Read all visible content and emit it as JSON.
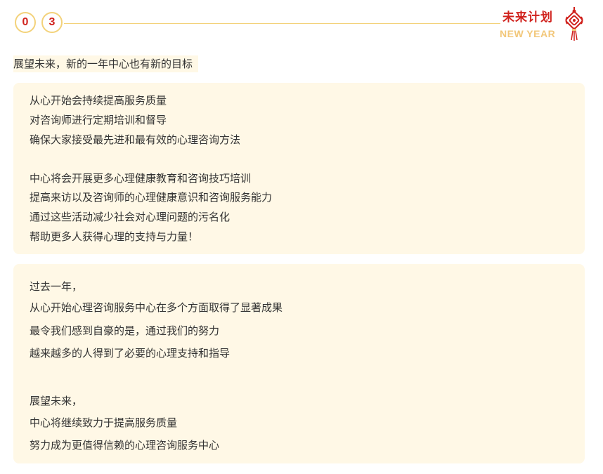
{
  "header": {
    "digits": [
      "0",
      "3"
    ],
    "title": "未来计划",
    "subtitle": "NEW YEAR",
    "ornament_icon": "chinese-knot-icon",
    "colors": {
      "red": "#d0211c",
      "gold": "#f2c77a",
      "line": "#f3d27a"
    }
  },
  "intro": "展望未来，新的一年中心也有新的目标",
  "card1": {
    "lines": [
      "从心开始会持续提高服务质量",
      "对咨询师进行定期培训和督导",
      "确保大家接受最先进和最有效的心理咨询方法",
      "中心将会开展更多心理健康教育和咨询技巧培训",
      "提高来访以及咨询师的心理健康意识和咨询服务能力",
      "通过这些活动减少社会对心理问题的污名化",
      "帮助更多人获得心理的支持与力量！"
    ]
  },
  "card2": {
    "lines": [
      "过去一年，",
      "从心开始心理咨询服务中心在多个方面取得了显著成果",
      "最令我们感到自豪的是，通过我们的努力",
      "越来越多的人得到了必要的心理支持和指导",
      "展望未来，",
      "中心将继续致力于提高服务质量",
      "努力成为更值得信赖的心理咨询服务中心"
    ]
  },
  "card_background": "#fff8e6"
}
